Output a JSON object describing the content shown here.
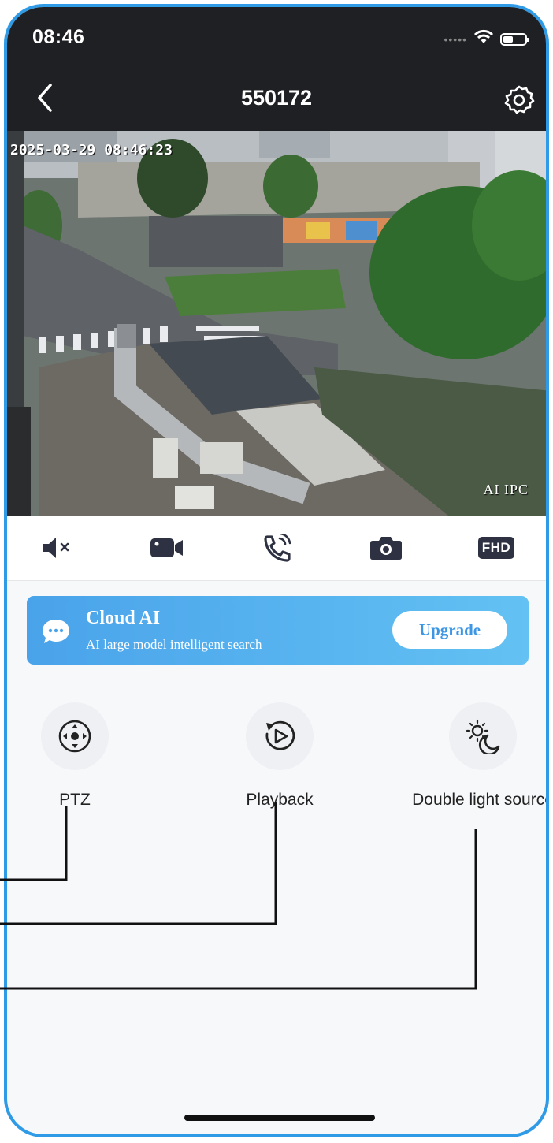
{
  "status_bar": {
    "time": "08:46"
  },
  "header": {
    "title": "550172",
    "back_icon": "chevron-left-icon",
    "settings_icon": "gear-icon"
  },
  "video": {
    "timestamp": "2025-03-29 08:46:23",
    "badge": "AI IPC"
  },
  "controls": [
    {
      "name": "mute",
      "icon": "speaker-mute-icon"
    },
    {
      "name": "record",
      "icon": "video-camera-icon"
    },
    {
      "name": "talk",
      "icon": "phone-call-icon"
    },
    {
      "name": "snapshot",
      "icon": "camera-icon"
    },
    {
      "name": "quality",
      "label": "FHD"
    }
  ],
  "cloud_ai": {
    "title": "Cloud AI",
    "subtitle": "AI large model intelligent search",
    "button": "Upgrade",
    "icon": "chat-bubble-icon"
  },
  "features": [
    {
      "label": "PTZ",
      "icon": "ptz-joystick-icon"
    },
    {
      "label": "Playback",
      "icon": "playback-icon"
    },
    {
      "label": "Double light source",
      "icon": "sun-moon-icon"
    }
  ],
  "colors": {
    "header_bg": "#1f2024",
    "accent": "#3c96e4",
    "frame": "#2f9be6"
  }
}
